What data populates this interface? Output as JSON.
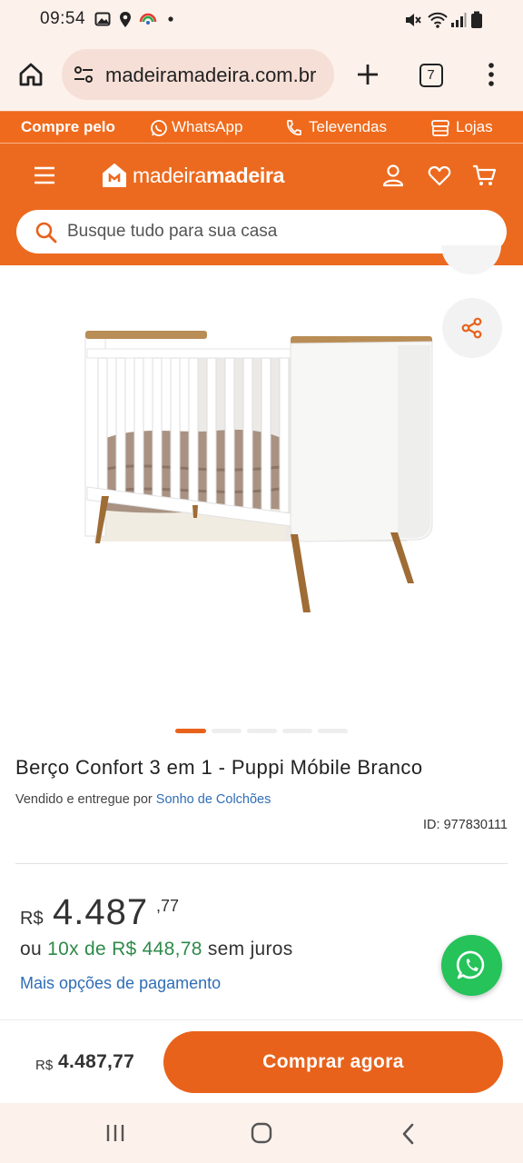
{
  "status_bar": {
    "time": "09:54",
    "icons": [
      "gallery-icon",
      "location-icon",
      "google-app-icon",
      "dot-icon",
      "mute-icon",
      "wifi-icon",
      "signal-icon",
      "battery-icon"
    ]
  },
  "browser": {
    "url": "madeiramadeira.com.br",
    "tab_count": "7",
    "icons": [
      "home-icon",
      "site-settings-icon",
      "new-tab-icon",
      "tabs-icon",
      "menu-dots-icon"
    ]
  },
  "promo_strip": {
    "lead": "Compre pelo",
    "whatsapp": "WhatsApp",
    "televendas": "Televendas",
    "lojas": "Lojas"
  },
  "header": {
    "logo_part1": "madeira",
    "logo_part2": "madeira",
    "search_placeholder": "Busque tudo para sua casa"
  },
  "gallery": {
    "image_subject": "white crib with wooden legs",
    "slide_count": 5,
    "active_slide": 1
  },
  "product": {
    "title": "Berço Confort 3 em 1 - Puppi Móbile Branco",
    "seller_prefix": "Vendido e entregue por",
    "seller_name": "Sonho de Colchões",
    "id_text": "ID: 977830111",
    "price_currency": "R$",
    "price_int": "4.487",
    "price_cents": ",77",
    "installments_prefix": "ou",
    "installments_value": "10x de R$ 448,78",
    "installments_suffix": "sem juros",
    "more_payment": "Mais opções de pagamento"
  },
  "buy_bar": {
    "currency": "R$",
    "price": "4.487,77",
    "button_label": "Comprar agora"
  },
  "colors": {
    "brand_orange": "#ec6a1f",
    "button_orange": "#e8621b",
    "link_blue": "#2f6db5",
    "green": "#2e8a4a",
    "whatsapp_green": "#25c35a"
  }
}
